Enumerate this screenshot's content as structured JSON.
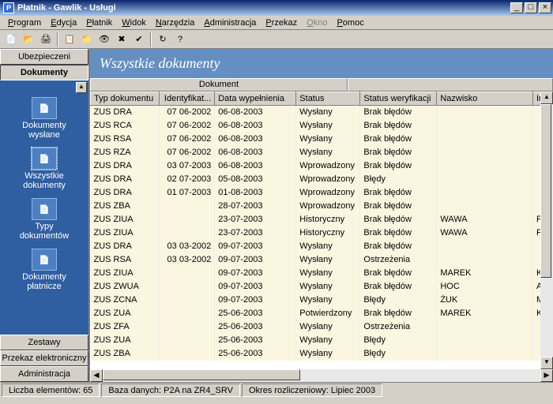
{
  "window": {
    "title": "Płatnik - Gawlik - Usługi",
    "icon_letter": "P"
  },
  "menu": [
    {
      "label": "Program",
      "u": "P"
    },
    {
      "label": "Edycja",
      "u": "E"
    },
    {
      "label": "Płatnik",
      "u": "P"
    },
    {
      "label": "Widok",
      "u": "W"
    },
    {
      "label": "Narzędzia",
      "u": "N"
    },
    {
      "label": "Administracja",
      "u": "A"
    },
    {
      "label": "Przekaz",
      "u": "P"
    },
    {
      "label": "Okno",
      "u": "O",
      "dim": true
    },
    {
      "label": "Pomoc",
      "u": "P"
    }
  ],
  "toolbar_icons": [
    "new-icon",
    "open-icon",
    "print-icon",
    "sep",
    "copy-icon",
    "folder-open-icon",
    "preview-icon",
    "delete-icon",
    "check-icon",
    "sep",
    "refresh-icon",
    "help-icon"
  ],
  "sidebar": {
    "top_buttons": [
      "Ubezpieczeni",
      "Dokumenty"
    ],
    "items": [
      {
        "label": "Dokumenty wysłane",
        "name": "nav-docs-sent"
      },
      {
        "label": "Wszystkie dokumenty",
        "name": "nav-all-docs",
        "selected": true
      },
      {
        "label": "Typy dokumentów",
        "name": "nav-doc-types"
      },
      {
        "label": "Dokumenty płatnicze",
        "name": "nav-payment-docs"
      }
    ],
    "bottom_buttons": [
      "Zestawy",
      "Przekaz elektroniczny",
      "Administracja"
    ]
  },
  "main": {
    "title": "Wszystkie dokumenty",
    "group_headers": {
      "left": "Dokument",
      "right": ""
    },
    "columns": [
      "Typ dokumentu",
      "Identyfikat...",
      "Data wypełnienia",
      "Status",
      "Status weryfikacji",
      "Nazwisko",
      "Im"
    ],
    "rows": [
      [
        "ZUS DRA",
        "07 06-2002",
        "06-08-2003",
        "Wysłany",
        "Brak błędów",
        "",
        ""
      ],
      [
        "ZUS RCA",
        "07 06-2002",
        "06-08-2003",
        "Wysłany",
        "Brak błędów",
        "",
        ""
      ],
      [
        "ZUS RSA",
        "07 06-2002",
        "06-08-2003",
        "Wysłany",
        "Brak błędów",
        "",
        ""
      ],
      [
        "ZUS RZA",
        "07 06-2002",
        "06-08-2003",
        "Wysłany",
        "Brak błędów",
        "",
        ""
      ],
      [
        "ZUS DRA",
        "03 07-2003",
        "06-08-2003",
        "Wprowadzony",
        "Brak błędów",
        "",
        ""
      ],
      [
        "ZUS DRA",
        "02 07-2003",
        "05-08-2003",
        "Wprowadzony",
        "Błędy",
        "",
        ""
      ],
      [
        "ZUS DRA",
        "01 07-2003",
        "01-08-2003",
        "Wprowadzony",
        "Brak błędów",
        "",
        ""
      ],
      [
        "ZUS ZBA",
        "",
        "28-07-2003",
        "Wprowadzony",
        "Brak błędów",
        "",
        ""
      ],
      [
        "ZUS ZIUA",
        "",
        "23-07-2003",
        "Historyczny",
        "Brak błędów",
        "WAWA",
        "PA"
      ],
      [
        "ZUS ZIUA",
        "",
        "23-07-2003",
        "Historyczny",
        "Brak błędów",
        "WAWA",
        "PA"
      ],
      [
        "ZUS DRA",
        "03 03-2002",
        "09-07-2003",
        "Wysłany",
        "Brak błędów",
        "",
        ""
      ],
      [
        "ZUS RSA",
        "03 03-2002",
        "09-07-2003",
        "Wysłany",
        "Ostrzeżenia",
        "",
        ""
      ],
      [
        "ZUS ZIUA",
        "",
        "09-07-2003",
        "Wysłany",
        "Brak błędów",
        "MAREK",
        "KF"
      ],
      [
        "ZUS ZWUA",
        "",
        "09-07-2003",
        "Wysłany",
        "Brak błędów",
        "HOC",
        "AN"
      ],
      [
        "ZUS ZCNA",
        "",
        "09-07-2003",
        "Wysłany",
        "Błędy",
        "ŻUK",
        "M."
      ],
      [
        "ZUS ZUA",
        "",
        "25-06-2003",
        "Potwierdzony",
        "Brak błędów",
        "MAREK",
        "KF"
      ],
      [
        "ZUS ZFA",
        "",
        "25-06-2003",
        "Wysłany",
        "Ostrzeżenia",
        "",
        ""
      ],
      [
        "ZUS ZUA",
        "",
        "25-06-2003",
        "Wysłany",
        "Błędy",
        "",
        ""
      ],
      [
        "ZUS ZBA",
        "",
        "25-06-2003",
        "Wysłany",
        "Błędy",
        "",
        ""
      ]
    ]
  },
  "status": {
    "count": "Liczba elementów: 65",
    "db": "Baza danych: P2A na ZR4_SRV",
    "period": "Okres rozliczeniowy: Lipiec 2003"
  }
}
